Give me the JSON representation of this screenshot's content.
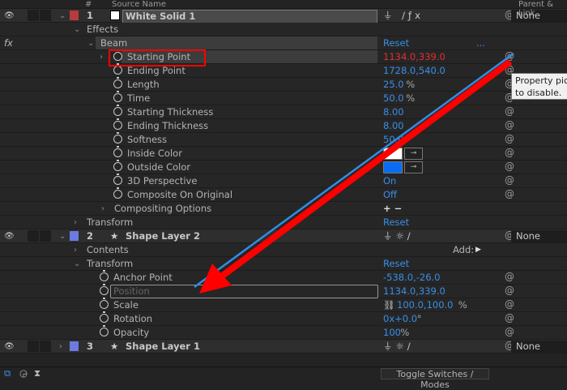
{
  "header": {
    "source_name": "Source Name",
    "parent_link": "Parent & Link",
    "number": "#"
  },
  "colors": {
    "value": "#3a8ee6",
    "changed_value": "#e03030",
    "layer1_label": "#b83a3a",
    "layer_label_blue": "#6c7be0",
    "arrow": "#ff0000",
    "line": "#2f8de4"
  },
  "layers": [
    {
      "number": "1",
      "name": "White Solid 1",
      "parent": "None"
    },
    {
      "number": "2",
      "name": "Shape Layer 2",
      "parent": "None"
    },
    {
      "number": "3",
      "name": "Shape Layer 1",
      "parent": "None"
    }
  ],
  "groups": {
    "effects": "Effects",
    "beam": "Beam",
    "beam_reset": "Reset",
    "beam_more": "...",
    "compositing_options": "Compositing Options",
    "transform1": "Transform",
    "transform1_reset": "Reset",
    "contents": "Contents",
    "add": "Add:",
    "transform2": "Transform",
    "transform2_reset": "Reset",
    "fx": "fx"
  },
  "beam_props": [
    {
      "name": "Starting Point",
      "value": "1134.0,339.0"
    },
    {
      "name": "Ending Point",
      "value": "1728.0,540.0"
    },
    {
      "name": "Length",
      "value": "25.0",
      "unit": "%"
    },
    {
      "name": "Time",
      "value": "50.0",
      "unit": "%"
    },
    {
      "name": "Starting Thickness",
      "value": "8.00"
    },
    {
      "name": "Ending Thickness",
      "value": "8.00"
    },
    {
      "name": "Softness",
      "value": "50.0"
    },
    {
      "name": "Inside Color",
      "color": "#ffffff"
    },
    {
      "name": "Outside Color",
      "color": "#0a6cf5"
    },
    {
      "name": "3D Perspective",
      "value": "On"
    },
    {
      "name": "Composite On Original",
      "value": "Off"
    }
  ],
  "transform_props": [
    {
      "name": "Anchor Point",
      "value": "-538.0,-26.0"
    },
    {
      "name": "Position",
      "value": "1134.0,339.0"
    },
    {
      "name": "Scale",
      "value": "100.0,100.0",
      "unit": "%"
    },
    {
      "name": "Rotation",
      "value": "0x+0.0",
      "unit": "°"
    },
    {
      "name": "Opacity",
      "value": "100",
      "unit": "%"
    }
  ],
  "compositing_plusminus": "+ −",
  "tooltip": {
    "line1": "Property pic",
    "line2": "to disable."
  },
  "footer": {
    "toggle": "Toggle Switches / Modes"
  }
}
